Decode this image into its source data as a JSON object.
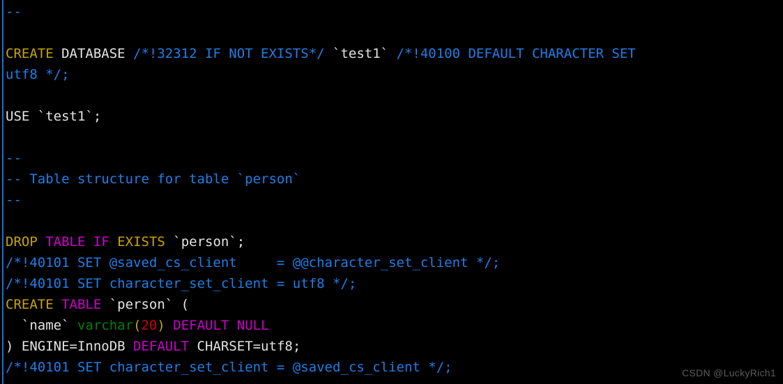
{
  "editor": {
    "background": "#000000",
    "left_rule_color": "#1874cd",
    "palette": {
      "keyword_gold": "#c8a400",
      "keyword_magenta": "#cc00cc",
      "comment_blue": "#1e7fe8",
      "plain_white": "#e4e4e4",
      "type_green": "#008000",
      "number_red": "#cc0000"
    }
  },
  "watermark": {
    "text": "CSDN @LuckyRich1"
  },
  "code": {
    "language": "sql",
    "lines": [
      {
        "n": 1,
        "tokens": [
          {
            "c": "comment",
            "t": "--"
          }
        ]
      },
      {
        "n": 2,
        "tokens": []
      },
      {
        "n": 3,
        "tokens": [
          {
            "c": "kw",
            "t": "CREATE"
          },
          {
            "c": "plain",
            "t": " DATABASE "
          },
          {
            "c": "comment",
            "t": "/*!32312 IF NOT EXISTS*/"
          },
          {
            "c": "plain",
            "t": " `test1` "
          },
          {
            "c": "comment",
            "t": "/*!40100 DEFAULT CHARACTER SET"
          }
        ]
      },
      {
        "n": 4,
        "wrapped": true,
        "tokens": [
          {
            "c": "comment",
            "t": "utf8 */;"
          }
        ]
      },
      {
        "n": 5,
        "tokens": []
      },
      {
        "n": 6,
        "tokens": [
          {
            "c": "plain",
            "t": "USE `test1`;"
          }
        ]
      },
      {
        "n": 7,
        "tokens": []
      },
      {
        "n": 8,
        "tokens": [
          {
            "c": "comment",
            "t": "--"
          }
        ]
      },
      {
        "n": 9,
        "tokens": [
          {
            "c": "comment",
            "t": "-- Table structure for table `person`"
          }
        ]
      },
      {
        "n": 10,
        "tokens": [
          {
            "c": "comment",
            "t": "--"
          }
        ]
      },
      {
        "n": 11,
        "tokens": []
      },
      {
        "n": 12,
        "tokens": [
          {
            "c": "kw",
            "t": "DROP"
          },
          {
            "c": "plain",
            "t": " "
          },
          {
            "c": "kw2",
            "t": "TABLE IF"
          },
          {
            "c": "plain",
            "t": " "
          },
          {
            "c": "kw",
            "t": "EXISTS"
          },
          {
            "c": "plain",
            "t": " `person`;"
          }
        ]
      },
      {
        "n": 13,
        "tokens": [
          {
            "c": "comment",
            "t": "/*!40101 SET @saved_cs_client     = @@character_set_client */;"
          }
        ]
      },
      {
        "n": 14,
        "tokens": [
          {
            "c": "comment",
            "t": "/*!40101 SET character_set_client = utf8 */;"
          }
        ]
      },
      {
        "n": 15,
        "tokens": [
          {
            "c": "kw",
            "t": "CREATE"
          },
          {
            "c": "plain",
            "t": " "
          },
          {
            "c": "kw2",
            "t": "TABLE"
          },
          {
            "c": "plain",
            "t": " `person` ("
          }
        ]
      },
      {
        "n": 16,
        "tokens": [
          {
            "c": "plain",
            "t": "  `name` "
          },
          {
            "c": "type",
            "t": "varchar"
          },
          {
            "c": "punct",
            "t": "("
          },
          {
            "c": "num",
            "t": "20"
          },
          {
            "c": "punct",
            "t": ")"
          },
          {
            "c": "plain",
            "t": " "
          },
          {
            "c": "kw2",
            "t": "DEFAULT NULL"
          }
        ]
      },
      {
        "n": 17,
        "tokens": [
          {
            "c": "plain",
            "t": ") ENGINE=InnoDB "
          },
          {
            "c": "kw2",
            "t": "DEFAULT"
          },
          {
            "c": "plain",
            "t": " CHARSET=utf8;"
          }
        ]
      },
      {
        "n": 18,
        "tokens": [
          {
            "c": "comment",
            "t": "/*!40101 SET character_set_client = @saved_cs_client */;"
          }
        ]
      }
    ]
  }
}
